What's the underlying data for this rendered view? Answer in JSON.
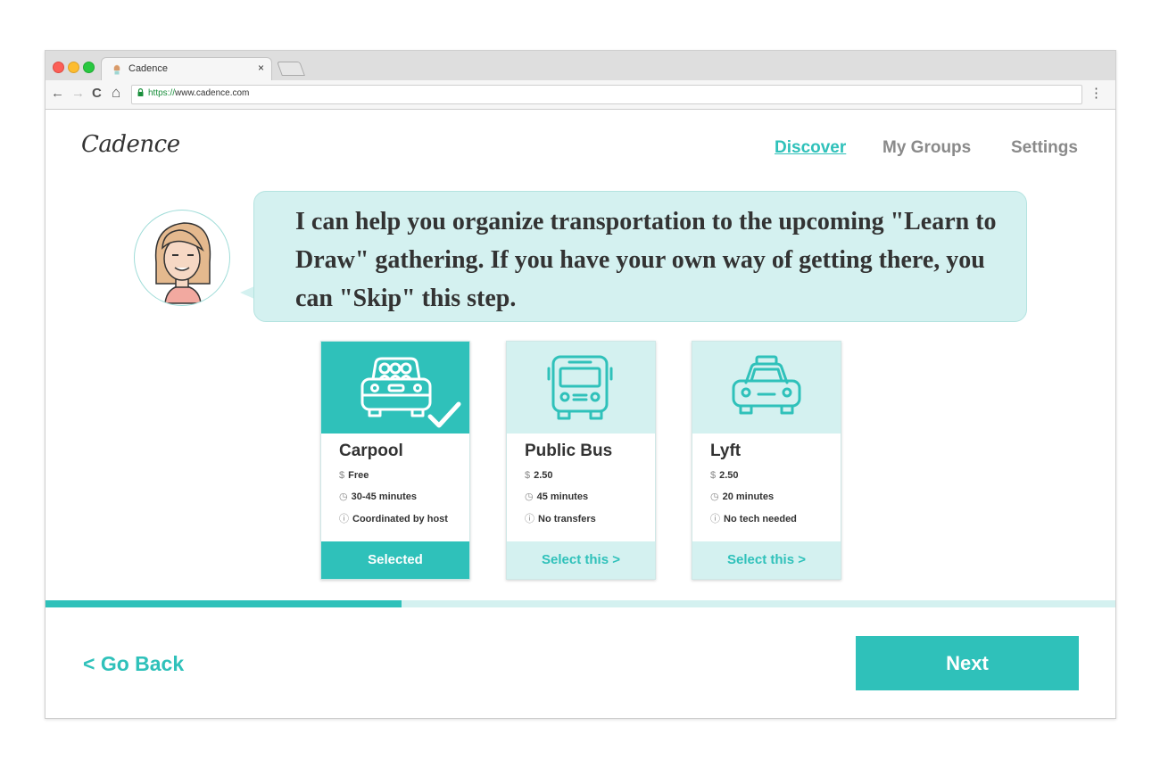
{
  "browser": {
    "tab_title": "Cadence",
    "tab_close": "×",
    "url_scheme": "https://",
    "url_rest": "www.cadence.com",
    "nav_back": "←",
    "nav_forward": "→",
    "nav_reload": "C",
    "nav_home": "⌂",
    "menu": "⋮"
  },
  "header": {
    "logo": "Cadence",
    "nav": [
      {
        "label": "Discover",
        "active": true
      },
      {
        "label": "My Groups",
        "active": false
      },
      {
        "label": "Settings",
        "active": false
      }
    ]
  },
  "assistant": {
    "message": "I can help you organize transportation to the upcoming \"Learn to Draw\" gathering. If you have your own way of getting there, you can \"Skip\" this step."
  },
  "options": [
    {
      "title": "Carpool",
      "icon": "carpool-car-icon",
      "price": "Free",
      "time": "30-45 minutes",
      "note": "Coordinated by host",
      "button": "Selected",
      "selected": true
    },
    {
      "title": "Public Bus",
      "icon": "bus-icon",
      "price": "2.50",
      "time": "45 minutes",
      "note": "No transfers",
      "button": "Select this >",
      "selected": false
    },
    {
      "title": "Lyft",
      "icon": "taxi-icon",
      "price": "2.50",
      "time": "20 minutes",
      "note": "No tech needed",
      "button": "Select this >",
      "selected": false
    }
  ],
  "row_icons": {
    "price": "$",
    "time": "◷",
    "note": "ⓘ"
  },
  "progress": {
    "fraction": 0.333
  },
  "footer": {
    "back_label": "< Go Back",
    "next_label": "Next"
  },
  "colors": {
    "accent": "#2fc1ba",
    "accent_light": "#d4f1f0",
    "text": "#333333",
    "muted": "#8a8a8a"
  }
}
